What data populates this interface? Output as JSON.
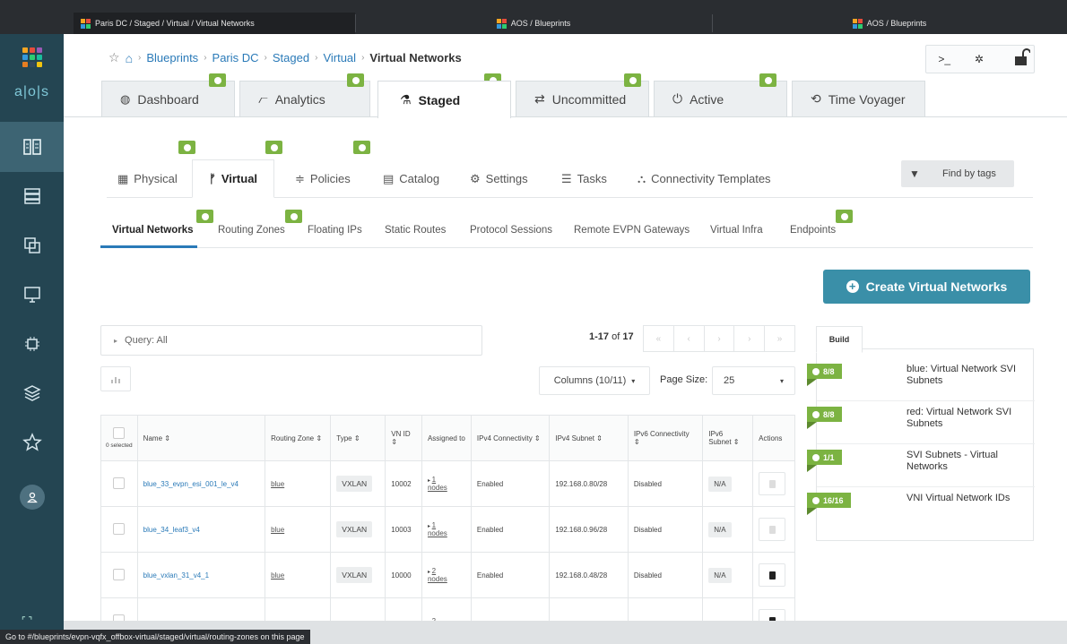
{
  "browser": {
    "tabs": [
      {
        "title": "Paris DC / Staged / Virtual / Virtual Networks",
        "active": true
      },
      {
        "title": "AOS / Blueprints",
        "active": false
      },
      {
        "title": "AOS / Blueprints",
        "active": false
      }
    ],
    "status_url": "Go to #/blueprints/evpn-vqfx_offbox-virtual/staged/virtual/routing-zones on this page"
  },
  "logo": {
    "text": "a|o|s"
  },
  "breadcrumb": {
    "items": [
      "Blueprints",
      "Paris DC",
      "Staged",
      "Virtual"
    ],
    "current": "Virtual Networks"
  },
  "header_tools": {
    "cli": ">_",
    "bug": "✲"
  },
  "main_tabs": [
    {
      "label": "Dashboard",
      "icon": "palette-icon"
    },
    {
      "label": "Analytics",
      "icon": "line-chart-icon"
    },
    {
      "label": "Staged",
      "icon": "flask-icon",
      "active": true
    },
    {
      "label": "Uncommitted",
      "icon": "exchange-icon"
    },
    {
      "label": "Active",
      "icon": "power-icon"
    },
    {
      "label": "Time Voyager",
      "icon": "history-icon"
    }
  ],
  "sub_tabs": [
    {
      "label": "Physical",
      "icon": "building-icon"
    },
    {
      "label": "Virtual",
      "icon": "branch-icon",
      "active": true
    },
    {
      "label": "Policies",
      "icon": "policy-icon"
    },
    {
      "label": "Catalog",
      "icon": "catalog-icon"
    },
    {
      "label": "Settings",
      "icon": "gears-icon"
    },
    {
      "label": "Tasks",
      "icon": "list-icon"
    },
    {
      "label": "Connectivity Templates",
      "icon": "sitemap-icon"
    }
  ],
  "find_by_tags": "Find by tags",
  "virtual_tabs": [
    {
      "label": "Virtual Networks",
      "active": true
    },
    {
      "label": "Routing Zones"
    },
    {
      "label": "Floating IPs"
    },
    {
      "label": "Static Routes"
    },
    {
      "label": "Protocol Sessions"
    },
    {
      "label": "Remote EVPN Gateways"
    },
    {
      "label": "Virtual Infra"
    },
    {
      "label": "Endpoints"
    }
  ],
  "create_button": "Create Virtual Networks",
  "query": "Query: All",
  "pager": {
    "range": "1-17",
    "of_label": "of",
    "total": "17",
    "buttons": [
      "«",
      "‹",
      "›",
      "›",
      "»"
    ]
  },
  "columns_select": "Columns (10/11)",
  "page_size_label": "Page Size:",
  "page_size_value": "25",
  "table": {
    "headers": {
      "selected": "0 selected",
      "name": "Name ⇕",
      "routing_zone": "Routing Zone ⇕",
      "type": "Type ⇕",
      "vn_id": "VN ID ⇕",
      "assigned_to": "Assigned to",
      "ipv4_conn": "IPv4 Connectivity ⇕",
      "ipv4_subnet": "IPv4 Subnet ⇕",
      "ipv6_conn": "IPv6 Connectivity ⇕",
      "ipv6_subnet": "IPv6 Subnet ⇕",
      "actions": "Actions"
    },
    "rows": [
      {
        "name": "blue_33_evpn_esi_001_le_v4",
        "zone": "blue",
        "type": "VXLAN",
        "vnid": "10002",
        "assigned_n": "1",
        "assigned_label": "nodes",
        "ipv4": "Enabled",
        "subnet4": "192.168.0.80/28",
        "ipv6": "Disabled",
        "subnet6": "N/A",
        "delete_enabled": false
      },
      {
        "name": "blue_34_leaf3_v4",
        "zone": "blue",
        "type": "VXLAN",
        "vnid": "10003",
        "assigned_n": "1",
        "assigned_label": "nodes",
        "ipv4": "Enabled",
        "subnet4": "192.168.0.96/28",
        "ipv6": "Disabled",
        "subnet6": "N/A",
        "delete_enabled": false
      },
      {
        "name": "blue_vxlan_31_v4_1",
        "zone": "blue",
        "type": "VXLAN",
        "vnid": "10000",
        "assigned_n": "2",
        "assigned_label": "nodes",
        "ipv4": "Enabled",
        "subnet4": "192.168.0.48/28",
        "ipv6": "Disabled",
        "subnet6": "N/A",
        "delete_enabled": true
      }
    ],
    "partial_row": {
      "assigned_n": "2"
    }
  },
  "build": {
    "tab": "Build",
    "items": [
      {
        "count": "8/8",
        "text": "blue: Virtual Network SVI Subnets"
      },
      {
        "count": "8/8",
        "text": "red: Virtual Network SVI Subnets"
      },
      {
        "count": "1/1",
        "text": "SVI Subnets - Virtual Networks"
      },
      {
        "count": "16/16",
        "text": "VNI Virtual Network IDs"
      }
    ]
  },
  "colors": {
    "accent": "#2a7ab8",
    "nav_bg": "#244552",
    "badge_green": "#7cb342",
    "create_btn": "#3a8fa8"
  }
}
